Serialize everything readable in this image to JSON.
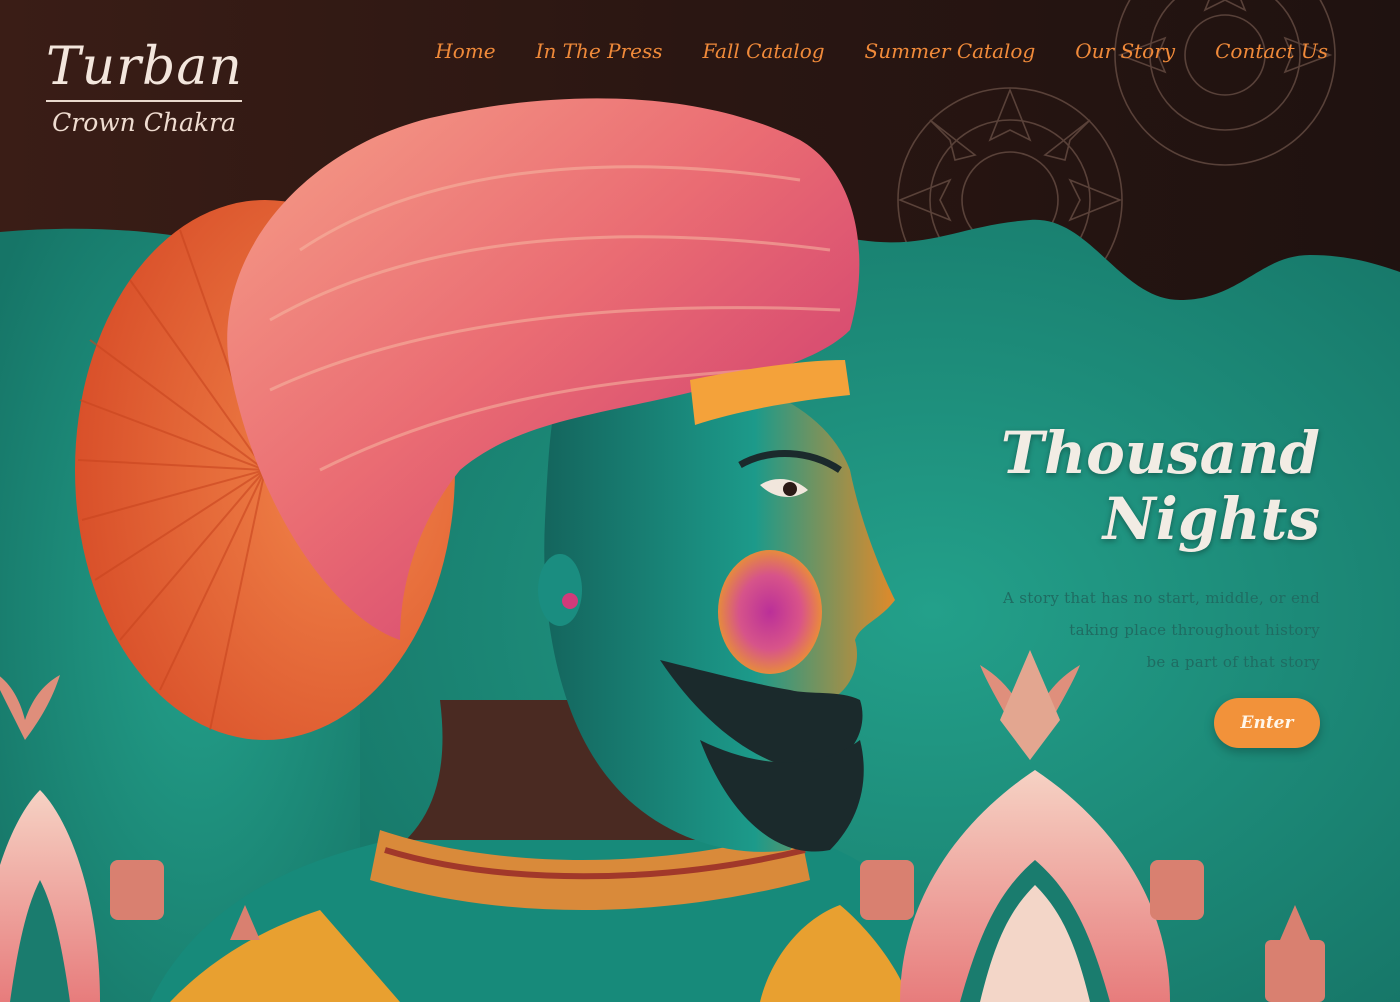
{
  "brand": {
    "title": "Turban",
    "subtitle": "Crown Chakra"
  },
  "nav": {
    "items": [
      {
        "label": "Home"
      },
      {
        "label": "In The Press"
      },
      {
        "label": "Fall Catalog"
      },
      {
        "label": "Summer Catalog"
      },
      {
        "label": "Our Story"
      },
      {
        "label": "Contact Us"
      }
    ]
  },
  "hero": {
    "title_line1": "Thousand",
    "title_line2": "Nights",
    "tagline": [
      "A story that has no start, middle, or end",
      "taking place throughout history",
      "be a part of that story"
    ],
    "cta_label": "Enter"
  },
  "colors": {
    "header_bg": "#2a1613",
    "teal": "#1f8f7c",
    "nav_orange": "#f08a3a",
    "button_orange": "#f2923a",
    "turban_pink": "#e8616b",
    "turban_orange": "#e8682f"
  },
  "illustration": {
    "subject": "man-in-pink-turban-profile",
    "decorations": [
      "mandala-pattern",
      "lotus-flowers",
      "domed-palace-roofs"
    ]
  }
}
